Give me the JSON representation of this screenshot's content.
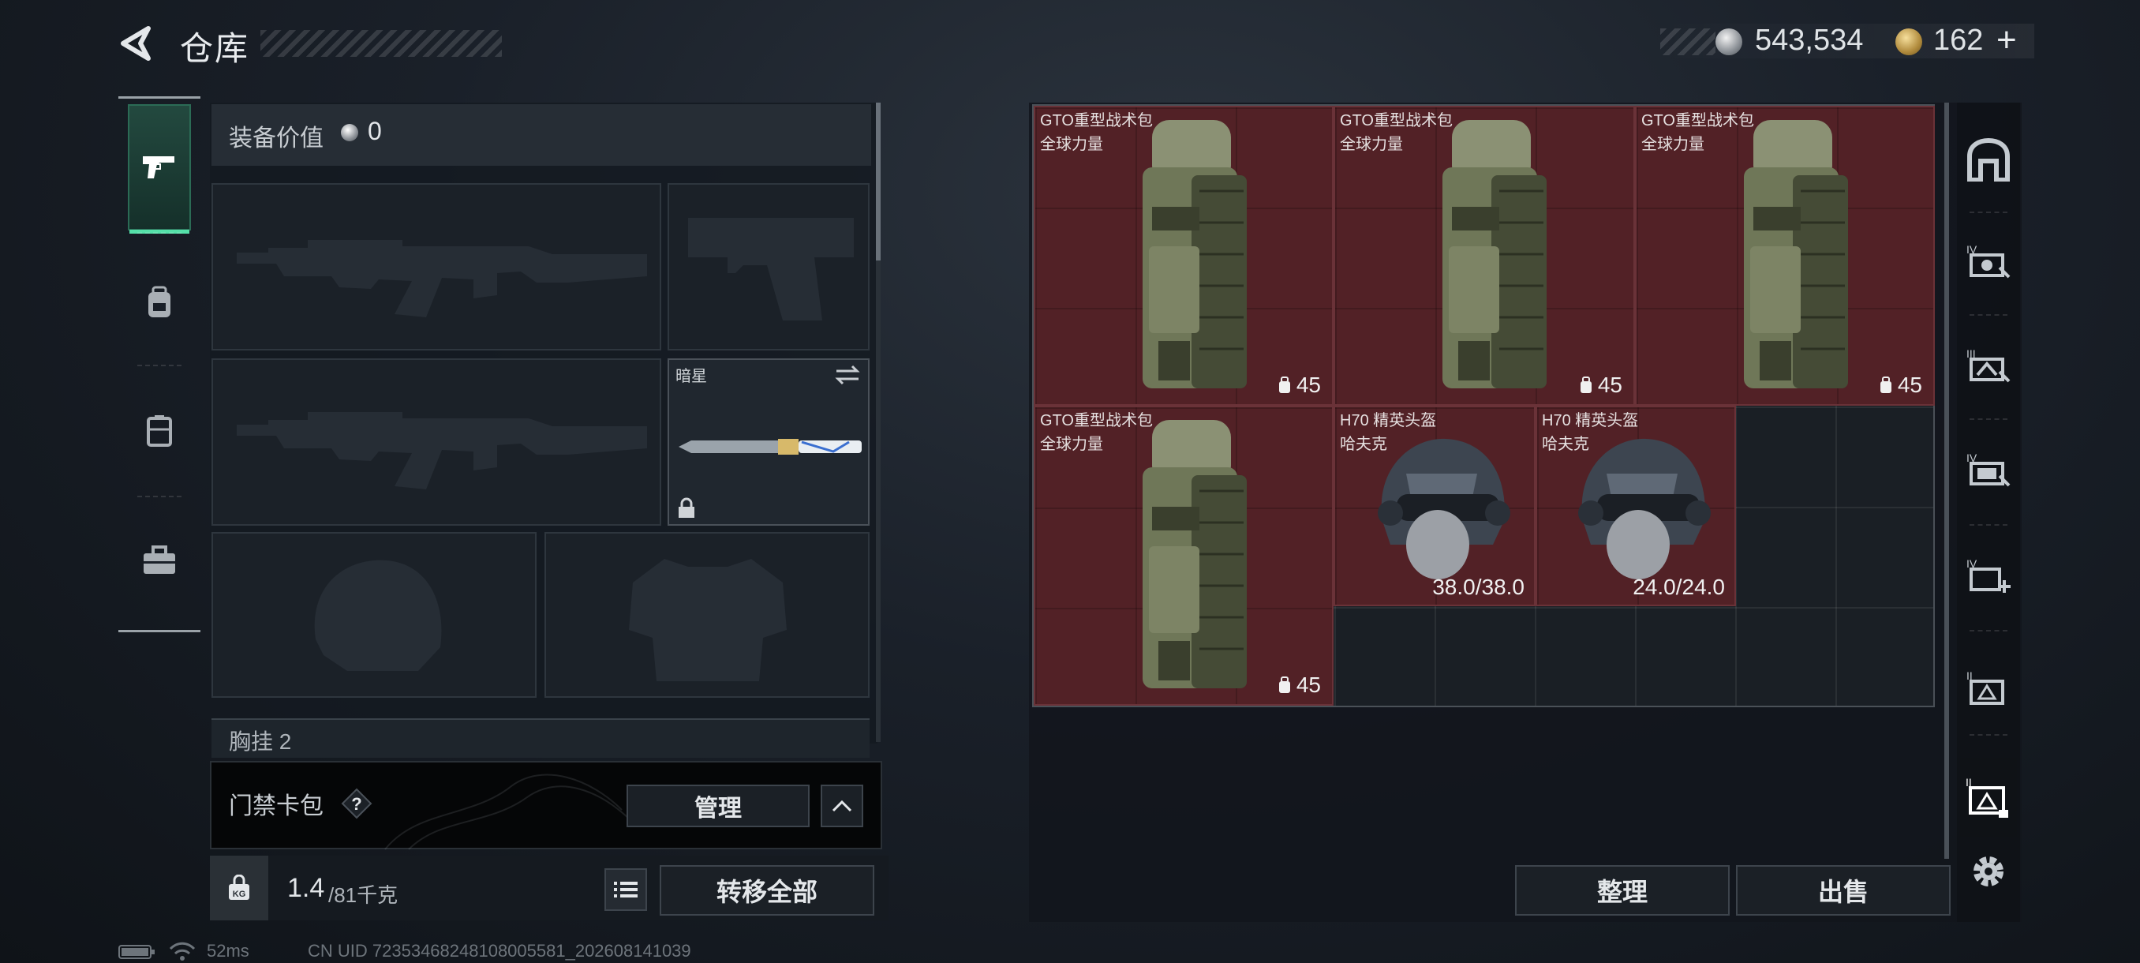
{
  "header": {
    "title": "仓库",
    "currency_silver": "543,534",
    "currency_gold": "162",
    "add_label": "+"
  },
  "nav": {
    "tabs": [
      {
        "name": "weapons",
        "icon": "pistol-icon",
        "selected": true
      },
      {
        "name": "gear",
        "icon": "backpack-icon",
        "selected": false
      },
      {
        "name": "containers",
        "icon": "case-icon",
        "selected": false
      },
      {
        "name": "kits",
        "icon": "toolbox-icon",
        "selected": false
      }
    ]
  },
  "loadout": {
    "value_label": "装备价值",
    "value": "0",
    "melee_name": "暗星",
    "chest_label": "胸挂 2",
    "slots": [
      "primary-weapon",
      "pistol",
      "secondary-weapon",
      "melee",
      "helmet",
      "body-armor"
    ]
  },
  "keycard": {
    "label": "门禁卡包",
    "help": "?",
    "manage_label": "管理"
  },
  "weight": {
    "current": "1.4",
    "max": "/81千克"
  },
  "actions": {
    "transfer_all": "转移全部",
    "sort": "整理",
    "sell": "出售"
  },
  "status": {
    "ping": "52ms",
    "uid": "CN UID 72353468248108005581_202608141039"
  },
  "storage": {
    "items": [
      {
        "name": "GTO重型战术包",
        "brand": "全球力量",
        "count": "45",
        "type": "backpack"
      },
      {
        "name": "GTO重型战术包",
        "brand": "全球力量",
        "count": "45",
        "type": "backpack"
      },
      {
        "name": "GTO重型战术包",
        "brand": "全球力量",
        "count": "45",
        "type": "backpack"
      },
      {
        "name": "GTO重型战术包",
        "brand": "全球力量",
        "count": "45",
        "type": "backpack"
      },
      {
        "name": "H70 精英头盔",
        "brand": "哈夫克",
        "durability": "38.0/38.0",
        "type": "helmet"
      },
      {
        "name": "H70 精英头盔",
        "brand": "哈夫克",
        "durability": "24.0/24.0",
        "type": "helmet"
      }
    ]
  },
  "right_sidebar": {
    "tabs": [
      "home-icon",
      "tier-iv-stash-1-icon",
      "tier-iii-stash-icon",
      "tier-iv-stash-2-icon",
      "tier-iv-add-icon",
      "tier-ii-stash-icon",
      "tier-i-stash-selected-icon",
      "settings-icon"
    ]
  },
  "colors": {
    "item_bg": "#522126",
    "selected_tab": "#23493f",
    "accent_green": "#55e0a9"
  }
}
